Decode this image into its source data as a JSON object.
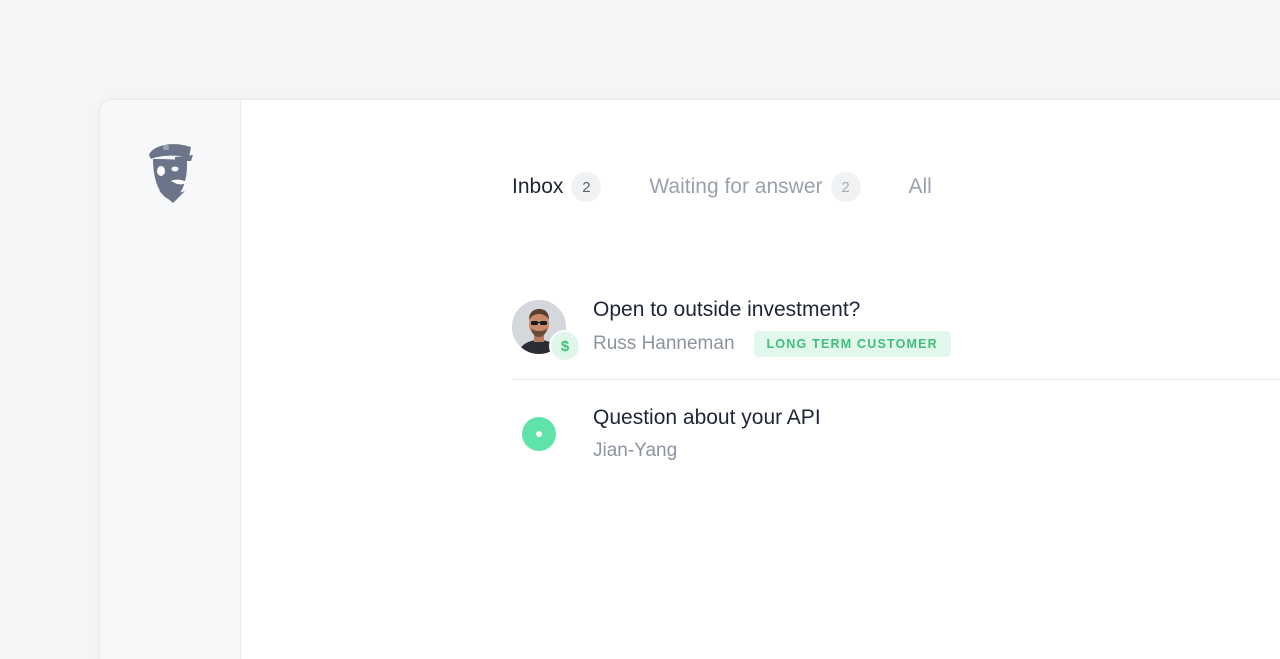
{
  "tabs": [
    {
      "label": "Inbox",
      "count": "2"
    },
    {
      "label": "Waiting for answer",
      "count": "2"
    },
    {
      "label": "All"
    }
  ],
  "conversations": [
    {
      "subject": "Open to outside investment?",
      "sender": "Russ Hanneman",
      "tag": "LONG TERM CUSTOMER",
      "badge": "$"
    },
    {
      "subject": "Question about your API",
      "sender": "Jian-Yang"
    }
  ],
  "colors": {
    "accent_green": "#3fbf7b",
    "dot_green": "#5fe3a9",
    "text_primary": "#1e2536",
    "text_muted": "#9aa1ad"
  },
  "icons": {
    "logo": "doorman-logo-icon"
  }
}
